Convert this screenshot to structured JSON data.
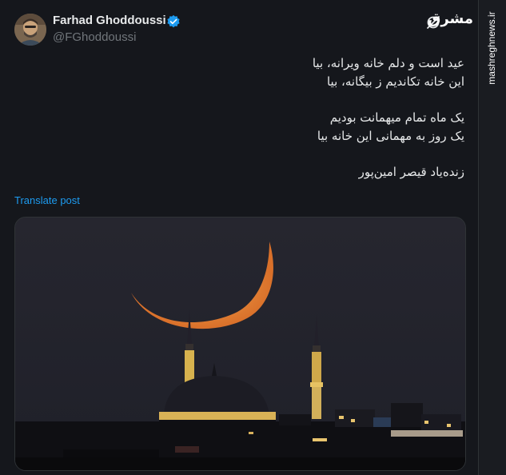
{
  "author": {
    "name": "Farhad Ghoddoussi",
    "handle": "@FGhoddoussi",
    "verified": true
  },
  "post": {
    "lines": [
      "عید است و دلم خانه ویرانه، بیا",
      "این خانه تکاندیم ز بیگانه، بیا",
      "",
      "یک ماه تمام میهمانت بودیم",
      "یک روز به مهمانی این خانه بیا",
      "",
      "زنده‌یاد قیصر امین‌پور"
    ],
    "translate_label": "Translate post"
  },
  "media": {
    "subject": "crescent moon over mosque at night"
  },
  "watermark": {
    "logo_text": "مشرق",
    "site": "mashreghnews.ir"
  },
  "colors": {
    "background": "#15171c",
    "text": "#e7e9ea",
    "muted": "#71767b",
    "link": "#1d9bf0",
    "verified": "#1d9bf0"
  },
  "icons": {
    "verified": "verified-badge-icon",
    "grok": "grok-icon"
  }
}
